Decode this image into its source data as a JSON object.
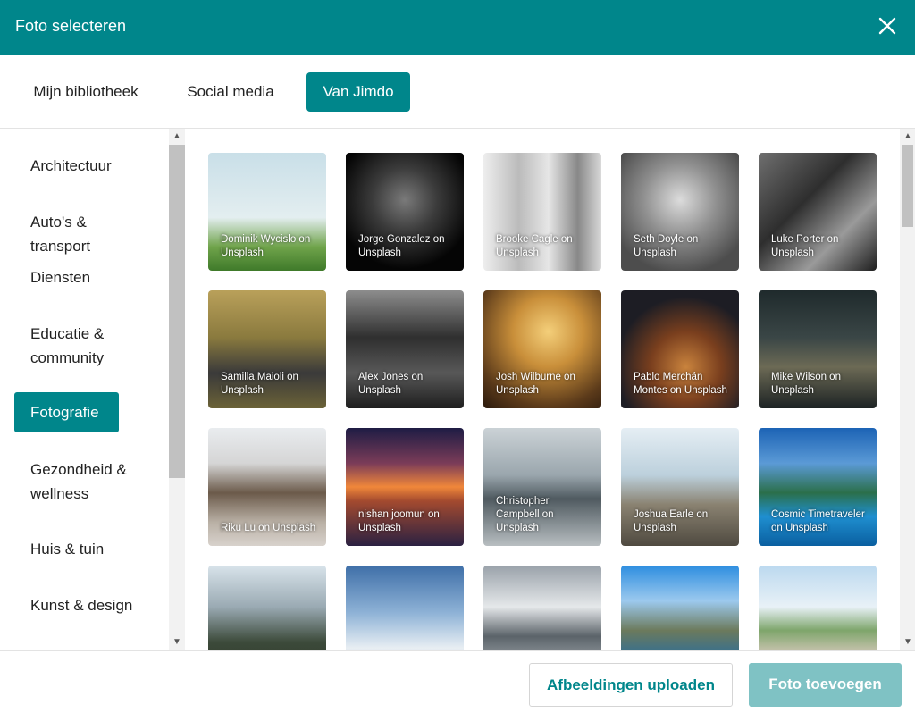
{
  "dialog": {
    "title": "Foto selecteren"
  },
  "tabs": [
    {
      "label": "Mijn bibliotheek"
    },
    {
      "label": "Social media"
    },
    {
      "label": "Van Jimdo"
    }
  ],
  "categories": [
    {
      "label": "Architectuur"
    },
    {
      "label": "Auto's & transport"
    },
    {
      "label": "Diensten"
    },
    {
      "label": "Educatie & community"
    },
    {
      "label": "Fotografie"
    },
    {
      "label": "Gezondheid & wellness"
    },
    {
      "label": "Huis & tuin"
    },
    {
      "label": "Kunst & design"
    }
  ],
  "photos": [
    {
      "credit": "Dominik Wycisło on Unsplash"
    },
    {
      "credit": "Jorge Gonzalez on Unsplash"
    },
    {
      "credit": "Brooke Cagle on Unsplash"
    },
    {
      "credit": "Seth Doyle on Unsplash"
    },
    {
      "credit": "Luke Porter on Unsplash"
    },
    {
      "credit": "Samilla Maioli on Unsplash"
    },
    {
      "credit": "Alex Jones on Unsplash"
    },
    {
      "credit": "Josh Wilburne on Unsplash"
    },
    {
      "credit": "Pablo Merchán Montes on Unsplash"
    },
    {
      "credit": "Mike Wilson on Unsplash"
    },
    {
      "credit": "Riku Lu on Unsplash"
    },
    {
      "credit": "nishan joomun on Unsplash"
    },
    {
      "credit": "Christopher Campbell on Unsplash"
    },
    {
      "credit": "Joshua Earle on Unsplash"
    },
    {
      "credit": "Cosmic Timetraveler on Unsplash"
    },
    {
      "credit": ""
    },
    {
      "credit": ""
    },
    {
      "credit": ""
    },
    {
      "credit": ""
    },
    {
      "credit": ""
    }
  ],
  "footer": {
    "upload_label": "Afbeeldingen uploaden",
    "add_label": "Foto toevoegen"
  },
  "colors": {
    "accent": "#00868b",
    "accent_disabled": "#7fc2c4"
  }
}
